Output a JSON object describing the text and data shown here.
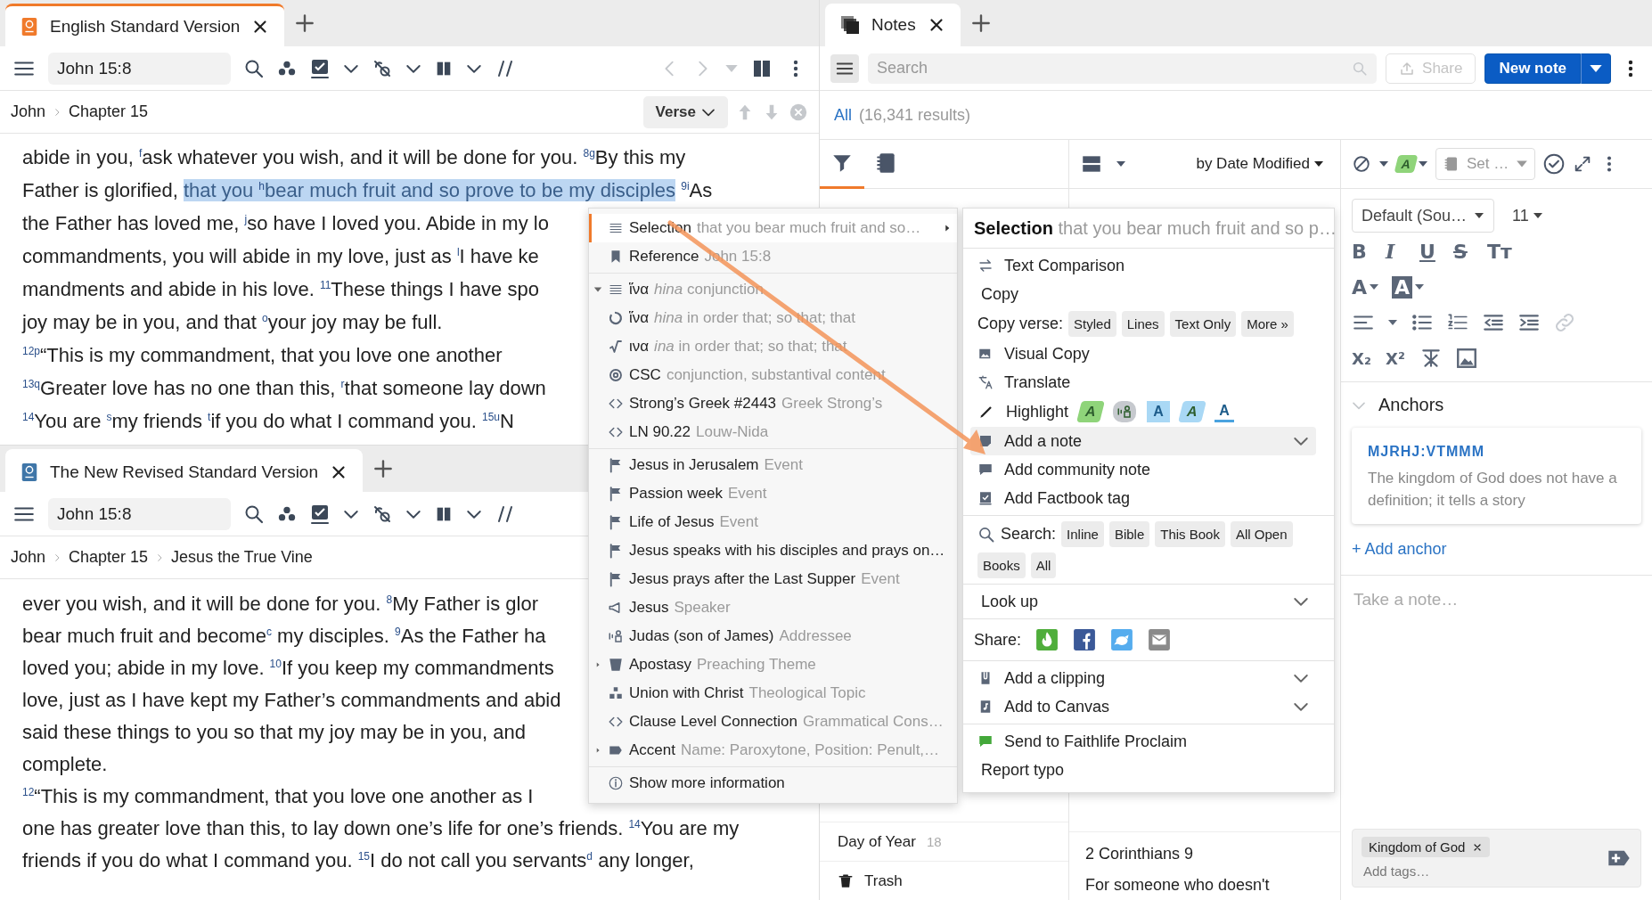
{
  "panes": [
    {
      "tab": {
        "title": "English Standard Version",
        "kind": "esv",
        "focused": true
      },
      "reference": "John 15:8",
      "breadcrumb": [
        "John",
        "Chapter 15"
      ],
      "unit": "Verse",
      "lines": [
        [
          {
            "text": "abide in you, $^{f}$ask whatever you wish, and it will be done for you. $^{8}$$^{g}$By this my",
            "highlighted": false
          }
        ],
        [
          {
            "text": "Father is glorified, ",
            "highlighted": false
          },
          {
            "text": "that you $^{h}$bear much fruit and so prove to be my disciples",
            "highlighted": true
          },
          {
            "text": " $^{9}$$^{i}$As",
            "highlighted": false
          }
        ],
        [
          {
            "text": "the Father has loved me, $^{j}$so have I loved you. Abide in my lo",
            "highlighted": false
          }
        ],
        [
          {
            "text": "commandments, you will abide in my love, just as $^{l}$I have ke",
            "highlighted": false
          }
        ],
        [
          {
            "text": "mandments and abide in his love. $^{11}$These things I have spo",
            "highlighted": false
          }
        ],
        [
          {
            "text": "joy may be in you, and that $^{o}$your joy may be full.",
            "highlighted": false
          }
        ],
        [
          {
            "text": "$^{12}$$^{p}$“This is my commandment, that you love one another",
            "highlighted": false
          }
        ],
        [
          {
            "text": "$^{13}$$^{q}$Greater love has no one than this, $^{r}$that someone lay down",
            "highlighted": false
          }
        ],
        [
          {
            "text": "$^{14}$You are $^{s}$my friends $^{t}$if you do what I command you. $^{15}$$^{u}$N",
            "highlighted": false
          }
        ]
      ]
    },
    {
      "tab": {
        "title": "The New Revised Standard Version",
        "kind": "nrsv",
        "focused": false
      },
      "reference": "John 15:8",
      "breadcrumb": [
        "John",
        "Chapter 15",
        "Jesus the True Vine"
      ],
      "lines": [
        [
          {
            "text": "ever you wish, and it will be done for you. $^{8}$My Father is glor",
            "highlighted": false
          }
        ],
        [
          {
            "text": "bear much fruit and become$^{c}$ my disciples. $^{9}$As the Father ha",
            "highlighted": false
          }
        ],
        [
          {
            "text": "loved you; abide in my love. $^{10}$If you keep my commandments",
            "highlighted": false
          }
        ],
        [
          {
            "text": "love, just as I have kept my Father’s commandments and abid",
            "highlighted": false
          }
        ],
        [
          {
            "text": "said these things to you so that my joy may be in you, and",
            "highlighted": false
          }
        ],
        [
          {
            "text": "complete.",
            "highlighted": false
          }
        ],
        [
          {
            "text": "$^{12}$“This is my commandment, that you love one another as I",
            "highlighted": false
          }
        ],
        [
          {
            "text": "one has greater love than this, to lay down one’s life for one’s friends. $^{14}$You are my",
            "highlighted": false
          }
        ],
        [
          {
            "text": "friends if you do what I command you. $^{15}$I do not call you servants$^{d}$ any longer,",
            "highlighted": false
          }
        ]
      ]
    }
  ],
  "context_menu": {
    "sections": [
      [
        {
          "kind": "selection",
          "label": "Selection",
          "detail": "that you bear much fruit and so…",
          "submenu": true,
          "selected": true
        },
        {
          "kind": "reference",
          "label": "Reference",
          "detail": "John 15:8",
          "selected": false
        }
      ],
      [
        {
          "kind": "lemma",
          "label": "ἵνα",
          "detail": "*hina* conjunction",
          "expanded": true,
          "selected": false
        },
        {
          "kind": "sense",
          "label": "ἵνα",
          "detail": "*hina* in order that; so that; that",
          "selected": false
        },
        {
          "kind": "root",
          "label": "ινα",
          "detail": "*ina* in order that; so that; that",
          "selected": false
        },
        {
          "kind": "morph",
          "label": "CSC",
          "detail": "conjunction, substantival content",
          "selected": false
        },
        {
          "kind": "link",
          "label": "Strong’s Greek #2443",
          "detail": "Greek Strong’s",
          "selected": false
        },
        {
          "kind": "link",
          "label": "LN 90.22",
          "detail": "Louw-Nida",
          "selected": false
        }
      ],
      [
        {
          "kind": "event",
          "label": "Jesus in Jerusalem",
          "detail": "Event",
          "selected": false
        },
        {
          "kind": "event",
          "label": "Passion week",
          "detail": "Event",
          "selected": false
        },
        {
          "kind": "event",
          "label": "Life of Jesus",
          "detail": "Event",
          "selected": false
        },
        {
          "kind": "event",
          "label": "Jesus speaks with his disciples and prays on…",
          "selected": false
        },
        {
          "kind": "event",
          "label": "Jesus prays after the Last Supper",
          "detail": "Event",
          "selected": false
        },
        {
          "kind": "speaker",
          "label": "Jesus",
          "detail": "Speaker",
          "selected": false
        },
        {
          "kind": "addressee",
          "label": "Judas (son of James)",
          "detail": "Addressee",
          "selected": false
        },
        {
          "kind": "theme",
          "label": "Apostasy",
          "detail": "Preaching Theme",
          "expanded": false,
          "selected": false
        },
        {
          "kind": "topic",
          "label": "Union with Christ",
          "detail": "Theological Topic",
          "selected": false
        },
        {
          "kind": "link",
          "label": "Clause Level Connection",
          "detail": "Grammatical Cons…",
          "selected": false
        },
        {
          "kind": "accent",
          "label": "Accent",
          "detail": "Name: Paroxytone, Position: Penult,…",
          "expanded": false,
          "selected": false
        }
      ],
      [
        {
          "kind": "info",
          "label": "Show more information",
          "selected": false
        }
      ]
    ]
  },
  "selection_menu": {
    "title": "Selection",
    "detail": "that you bear much fruit and so p…",
    "sections": [
      [
        {
          "kind": "text-comparison",
          "label": "Text Comparison",
          "selected": false
        },
        {
          "kind": "copy",
          "label": "Copy",
          "selected": false
        },
        {
          "kind": "copy-verse",
          "label": "Copy verse:",
          "chips": [
            "Styled",
            "Lines",
            "Text Only",
            "More »"
          ]
        },
        {
          "kind": "visual-copy",
          "label": "Visual Copy",
          "selected": false
        },
        {
          "kind": "translate",
          "label": "Translate",
          "selected": false
        },
        {
          "kind": "highlight",
          "label": "Highlight",
          "swatches": [
            {
              "kind": "marker",
              "label": "A",
              "color": "#8fd47a"
            },
            {
              "kind": "person",
              "color": "#c6c9ce"
            },
            {
              "kind": "box",
              "label": "A",
              "color": "#a9d8f5"
            },
            {
              "kind": "marker",
              "label": "A",
              "color": "#a9d8f5"
            },
            {
              "kind": "underline",
              "label": "A",
              "color": "#4aa3df"
            }
          ]
        },
        {
          "kind": "note",
          "label": "Add a note",
          "submenu": true,
          "selected": true
        },
        {
          "kind": "community-note",
          "label": "Add community note",
          "selected": false
        },
        {
          "kind": "factbook",
          "label": "Add Factbook tag",
          "selected": false
        }
      ],
      [
        {
          "kind": "search",
          "label": "Search:",
          "chips": [
            "Inline",
            "Bible",
            "This Book",
            "All Open",
            "Books",
            "All"
          ]
        }
      ],
      [
        {
          "kind": "look-up",
          "label": "Look up",
          "submenu": true,
          "selected": false
        }
      ],
      [
        {
          "kind": "share",
          "label": "Share:",
          "targets": [
            {
              "kind": "proclaim"
            },
            {
              "kind": "facebook"
            },
            {
              "kind": "twitter"
            },
            {
              "kind": "email"
            }
          ]
        }
      ],
      [
        {
          "kind": "clipping",
          "label": "Add a clipping",
          "submenu": true,
          "selected": false
        },
        {
          "kind": "canvas",
          "label": "Add to Canvas",
          "submenu": true,
          "selected": false
        }
      ],
      [
        {
          "kind": "proclaim",
          "label": "Send to Faithlife Proclaim",
          "selected": false
        },
        {
          "kind": "copy",
          "label": "Report typo",
          "selected": false
        }
      ]
    ]
  },
  "notes": {
    "tab": {
      "title": "Notes"
    },
    "search": {
      "placeholder": "Search"
    },
    "share": {
      "label": "Share",
      "disabled": true
    },
    "new_note": {
      "label": "New note"
    },
    "results": {
      "link": "All",
      "count": "(16,341 results)"
    },
    "side_tabs": [
      {
        "kind": "filter",
        "selected": true
      },
      {
        "kind": "notebooks",
        "selected": false
      }
    ],
    "sort": {
      "label": "by Date Modified"
    },
    "style_swatch": {
      "label": "A",
      "color": "#8fd47a"
    },
    "notebook_picker": {
      "label": "Set …"
    },
    "side_list": [
      {
        "kind": "group",
        "label": "Day of Year",
        "count": "18"
      },
      {
        "kind": "trash",
        "label": "Trash"
      }
    ],
    "note_list": [
      {
        "title": "2 Corinthians 9",
        "excerpt": "For someone who doesn't"
      }
    ],
    "editor": {
      "font": "Default (Sou…",
      "size": "11",
      "format_rows": [
        [
          {
            "kind": "bold",
            "label": "B"
          },
          {
            "kind": "italic",
            "label": "I"
          },
          {
            "kind": "underline",
            "label": "U"
          },
          {
            "kind": "strike",
            "label": "S"
          },
          {
            "kind": "text-size",
            "label": "Tᴛ"
          }
        ],
        [
          {
            "kind": "font-color",
            "label": "A"
          },
          {
            "kind": "highlight-color",
            "label": "A"
          }
        ],
        [
          {
            "kind": "align"
          },
          {
            "kind": "bullets"
          },
          {
            "kind": "numbering"
          },
          {
            "kind": "outdent"
          },
          {
            "kind": "indent"
          },
          {
            "kind": "link",
            "disabled": true
          }
        ],
        [
          {
            "kind": "subscript",
            "label": "X₂"
          },
          {
            "kind": "superscript",
            "label": "X²"
          },
          {
            "kind": "clear-format"
          },
          {
            "kind": "image"
          }
        ]
      ],
      "anchors": {
        "title": "Anchors",
        "expanded": true,
        "items": [
          {
            "code": "MJRHJ:VTMMM",
            "text": "The kingdom of God does not have a definition; it tells a story"
          }
        ],
        "add": "+ Add anchor"
      },
      "body": {
        "placeholder": "Take a note…"
      },
      "tags": {
        "items": [
          "Kingdom of God"
        ],
        "placeholder": "Add tags…"
      }
    }
  }
}
